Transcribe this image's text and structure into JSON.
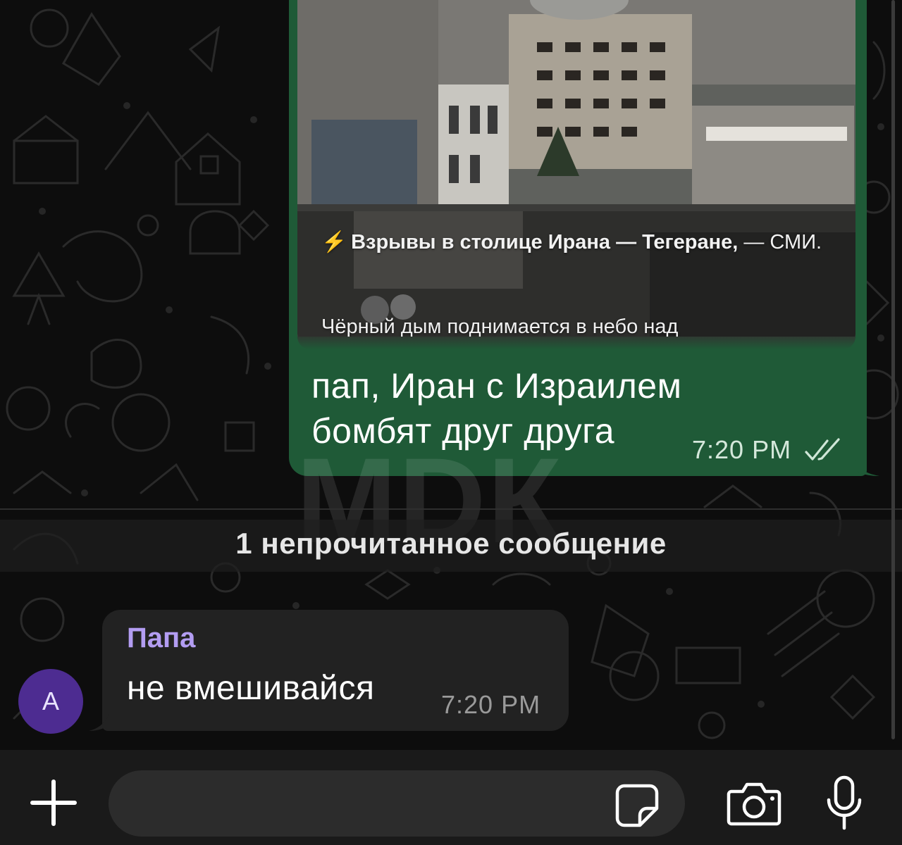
{
  "outgoing": {
    "media": {
      "headline_emoji": "⚡",
      "headline_bold": "Взрывы в столице Ирана — Тегеране,",
      "headline_normal": "— СМИ.",
      "body": "Чёрный дым поднимается в небо над"
    },
    "text": "пап, Иран с Израилем бомбят друг друга",
    "time": "7:20 PM",
    "status": "read"
  },
  "divider": {
    "label": "1 непрочитанное сообщение"
  },
  "incoming": {
    "sender": "Папа",
    "text": "не вмешивайся",
    "time": "7:20 PM",
    "avatar_letter": "А",
    "avatar_color": "#4d2c91"
  },
  "watermark": "МDК",
  "composer": {
    "placeholder": "",
    "icons": [
      "plus-icon",
      "sticker-icon",
      "camera-icon",
      "microphone-icon"
    ]
  },
  "colors": {
    "outgoing_bubble": "#1f5a37",
    "incoming_bubble": "#222222",
    "sender_name": "#b39df2",
    "background": "#0d0d0d"
  }
}
